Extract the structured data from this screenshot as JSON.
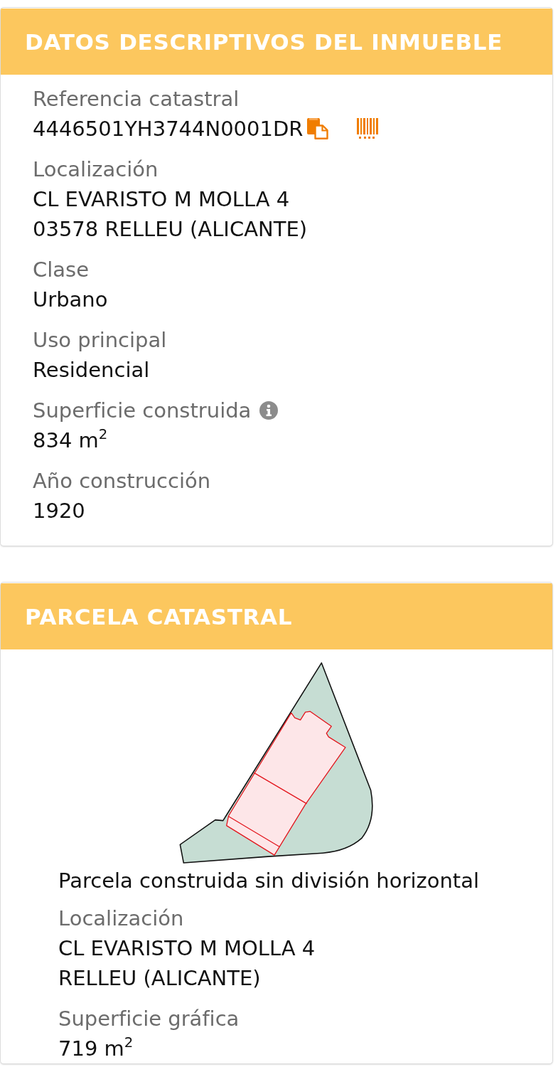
{
  "sections": [
    {
      "kind": "property",
      "title": "DATOS DESCRIPTIVOS DEL INMUEBLE",
      "fields": [
        {
          "kind": "reference",
          "label": "Referencia catastral",
          "lines": [
            "4446501YH3744N0001DR"
          ]
        },
        {
          "kind": "text",
          "label": "Localización",
          "lines": [
            "CL EVARISTO M MOLLA 4",
            "03578 RELLEU (ALICANTE)"
          ]
        },
        {
          "kind": "text",
          "label": "Clase",
          "lines": [
            "Urbano"
          ]
        },
        {
          "kind": "text",
          "label": "Uso principal",
          "lines": [
            "Residencial"
          ]
        },
        {
          "kind": "info",
          "label": "Superficie construida",
          "lines": [
            "834 m$^{2}$"
          ]
        },
        {
          "kind": "text",
          "label": "Año construcción",
          "lines": [
            "1920"
          ]
        }
      ]
    },
    {
      "kind": "parcel",
      "title": "PARCELA CATASTRAL",
      "caption": "Parcela construida sin división horizontal",
      "fields": [
        {
          "kind": "text",
          "label": "Localización",
          "lines": [
            "CL EVARISTO M MOLLA 4",
            "RELLEU (ALICANTE)"
          ]
        },
        {
          "kind": "text",
          "label": "Superficie gráfica",
          "lines": [
            "719 m$^{2}$"
          ]
        }
      ]
    }
  ]
}
